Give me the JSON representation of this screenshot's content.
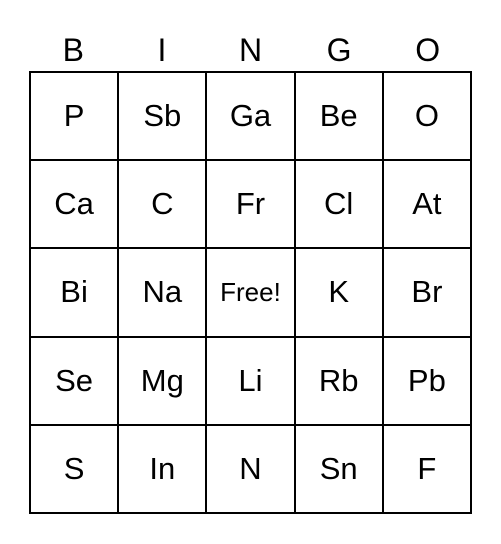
{
  "header": {
    "letters": [
      "B",
      "I",
      "N",
      "G",
      "O"
    ]
  },
  "card": {
    "rows": [
      [
        "P",
        "Sb",
        "Ga",
        "Be",
        "O"
      ],
      [
        "Ca",
        "C",
        "Fr",
        "Cl",
        "At"
      ],
      [
        "Bi",
        "Na",
        "Free!",
        "K",
        "Br"
      ],
      [
        "Se",
        "Mg",
        "Li",
        "Rb",
        "Pb"
      ],
      [
        "S",
        "In",
        "N",
        "Sn",
        "F"
      ]
    ]
  }
}
